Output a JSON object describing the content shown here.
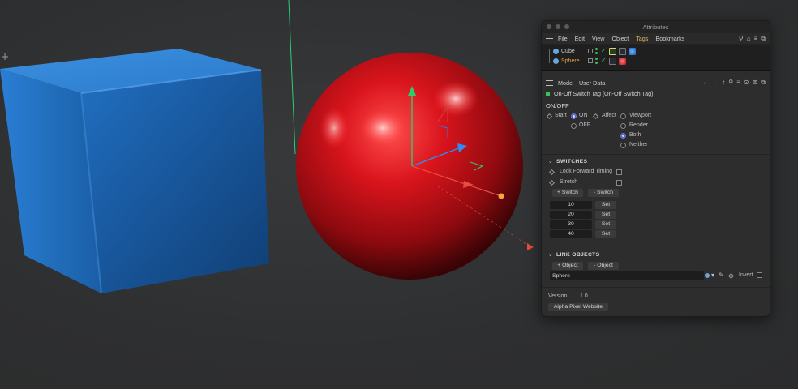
{
  "window": {
    "title": "Attributes"
  },
  "menu": {
    "items": [
      "File",
      "Edit",
      "View",
      "Object",
      "Tags",
      "Bookmarks"
    ],
    "active": "Tags"
  },
  "objects": [
    {
      "name": "Cube",
      "icon_color": "#5b9bd5",
      "selected": false
    },
    {
      "name": "Sphere",
      "icon_color": "#5b9bd5",
      "selected": true
    }
  ],
  "mode": {
    "items": [
      "Mode",
      "User Data"
    ]
  },
  "tag": {
    "title": "On-Off Switch Tag [On-Off Switch Tag]"
  },
  "onoff": {
    "heading": "ON/OFF",
    "start_label": "Start",
    "start_options": [
      {
        "label": "ON",
        "checked": true
      },
      {
        "label": "OFF",
        "checked": false
      }
    ],
    "affect_label": "Affect",
    "affect_options": [
      {
        "label": "Viewport",
        "checked": false
      },
      {
        "label": "Render",
        "checked": false
      },
      {
        "label": "Both",
        "checked": true
      },
      {
        "label": "Neither",
        "checked": false
      }
    ]
  },
  "switches": {
    "heading": "SWITCHES",
    "lock_label": "Lock Forward Timing",
    "stretch_label": "Stretch",
    "add_label": "+ Switch",
    "remove_label": "- Switch",
    "values": [
      "10",
      "20",
      "30",
      "40"
    ],
    "set_label": "Set"
  },
  "links": {
    "heading": "LINK OBJECTS",
    "add_label": "+ Object",
    "remove_label": "- Object",
    "field_value": "Sphere",
    "invert_label": "Invert"
  },
  "footer": {
    "version_label": "Version",
    "version_value": "1.0",
    "website_label": "Alpha Pixel Website"
  },
  "colors": {
    "accent_tab": "#e5b95a",
    "selected_object": "#e8a13c",
    "cube": "#1e5fa8",
    "sphere": "#c4121a",
    "axis_y": "#2ecc71",
    "axis_z": "#2f8ef5",
    "axis_x": "#e74c3c"
  }
}
